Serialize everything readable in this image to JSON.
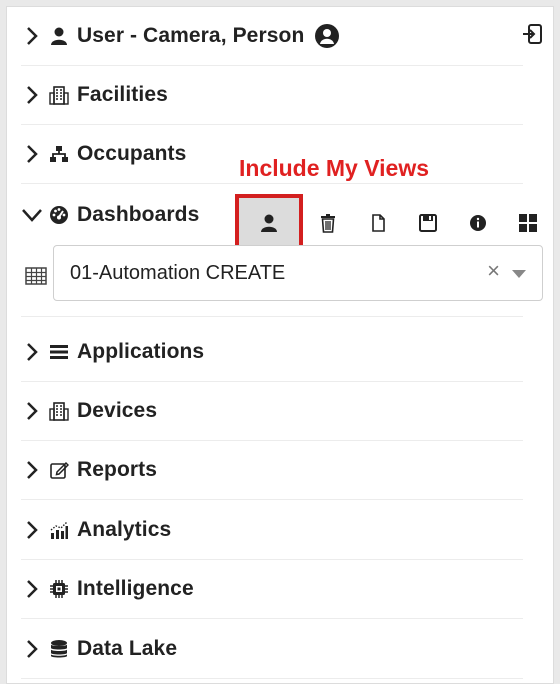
{
  "menu": {
    "user": {
      "label": "User - Camera, Person"
    },
    "facilities": {
      "label": "Facilities"
    },
    "occupants": {
      "label": "Occupants"
    },
    "dashboards": {
      "label": "Dashboards"
    },
    "applications": {
      "label": "Applications"
    },
    "devices": {
      "label": "Devices"
    },
    "reports": {
      "label": "Reports"
    },
    "analytics": {
      "label": "Analytics"
    },
    "intelligence": {
      "label": "Intelligence"
    },
    "datalake": {
      "label": "Data Lake"
    }
  },
  "annotation": {
    "text": "Include My Views"
  },
  "dashboard_select": {
    "value": "01-Automation CREATE",
    "clear": "×"
  },
  "icons": {
    "toolbar": [
      "user-icon",
      "trash-icon",
      "copy-icon",
      "save-icon",
      "info-icon",
      "grid-icon"
    ]
  },
  "colors": {
    "annotation": "#e02121",
    "highlight_border": "#d31f1f",
    "active_bg": "#dcdcdc"
  }
}
